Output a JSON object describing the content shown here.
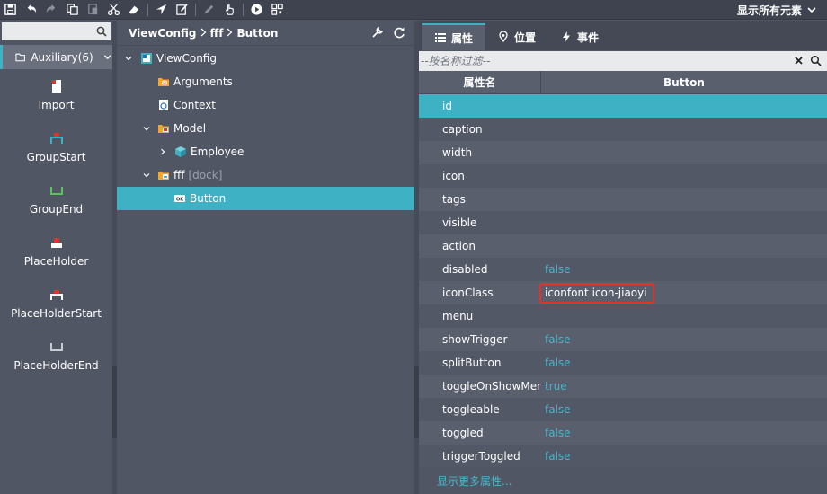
{
  "toolbar": {
    "right_label": "显示所有元素"
  },
  "palette": {
    "dropdown_label": "Auxiliary(6)",
    "items": [
      {
        "label": "Import"
      },
      {
        "label": "GroupStart"
      },
      {
        "label": "GroupEnd"
      },
      {
        "label": "PlaceHolder"
      },
      {
        "label": "PlaceHolderStart"
      },
      {
        "label": "PlaceHolderEnd"
      }
    ]
  },
  "breadcrumb": [
    "ViewConfig",
    "fff",
    "Button"
  ],
  "tree": {
    "root": "ViewConfig",
    "arguments": "Arguments",
    "context": "Context",
    "model": "Model",
    "employee": "Employee",
    "fff": "fff",
    "fff_tag": "[dock]",
    "button": "Button"
  },
  "tabs": [
    {
      "label": "属性"
    },
    {
      "label": "位置"
    },
    {
      "label": "事件"
    }
  ],
  "filter": {
    "placeholder": "--按名称过滤--"
  },
  "grid": {
    "col_name": "属性名",
    "col_value": "Button",
    "rows": [
      {
        "name": "id",
        "value": ""
      },
      {
        "name": "caption",
        "value": ""
      },
      {
        "name": "width",
        "value": ""
      },
      {
        "name": "icon",
        "value": ""
      },
      {
        "name": "tags",
        "value": ""
      },
      {
        "name": "visible",
        "value": ""
      },
      {
        "name": "action",
        "value": ""
      },
      {
        "name": "disabled",
        "value": "false"
      },
      {
        "name": "iconClass",
        "value": "iconfont icon-jiaoyi"
      },
      {
        "name": "menu",
        "value": ""
      },
      {
        "name": "showTrigger",
        "value": "false"
      },
      {
        "name": "splitButton",
        "value": "false"
      },
      {
        "name": "toggleOnShowMen",
        "value": "true"
      },
      {
        "name": "toggleable",
        "value": "false"
      },
      {
        "name": "toggled",
        "value": "false"
      },
      {
        "name": "triggerToggled",
        "value": "false"
      }
    ],
    "more_label": "显示更多属性..."
  },
  "colors": {
    "accent": "#3fb1c4",
    "highlight": "#e0342a"
  }
}
